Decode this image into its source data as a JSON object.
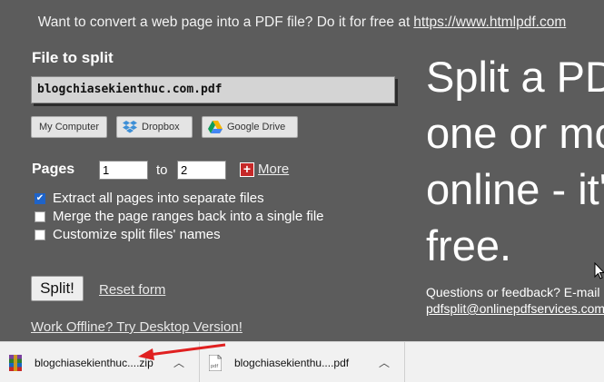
{
  "banner": {
    "text": "Want to convert a web page into a PDF file? Do it for free at",
    "link": "https://www.htmlpdf.com"
  },
  "form": {
    "file_label": "File to split",
    "file_value": "blogchiasekienthuc.com.pdf",
    "sources": {
      "my_computer": "My Computer",
      "dropbox": "Dropbox",
      "google_drive": "Google Drive"
    },
    "pages_label": "Pages",
    "page_from": "1",
    "to_label": "to",
    "page_to": "2",
    "more_label": "More",
    "options": [
      {
        "label": "Extract all pages into separate files",
        "checked": true
      },
      {
        "label": "Merge the page ranges back into a single file",
        "checked": false
      },
      {
        "label": "Customize split files' names",
        "checked": false
      }
    ],
    "split_label": "Split!",
    "reset_label": "Reset form",
    "offline_label": "Work Offline? Try Desktop Version!"
  },
  "hero": {
    "line1": "Split a PDF",
    "line2": "one or more",
    "line3": "online - it's",
    "line4": "free.",
    "questions": "Questions or feedback? E-mail",
    "email": "pdfsplit@onlinepdfservices.com"
  },
  "downloads": [
    {
      "name": "blogchiasekienthuc....zip",
      "icon": "zip-archive-icon"
    },
    {
      "name": "blogchiasekienthu....pdf",
      "icon": "pdf-file-icon"
    }
  ],
  "colors": {
    "page_bg": "#5c5c5c",
    "arrow": "#e02020",
    "checkbox_checked": "#1e63c8",
    "more_plus": "#c62828"
  }
}
